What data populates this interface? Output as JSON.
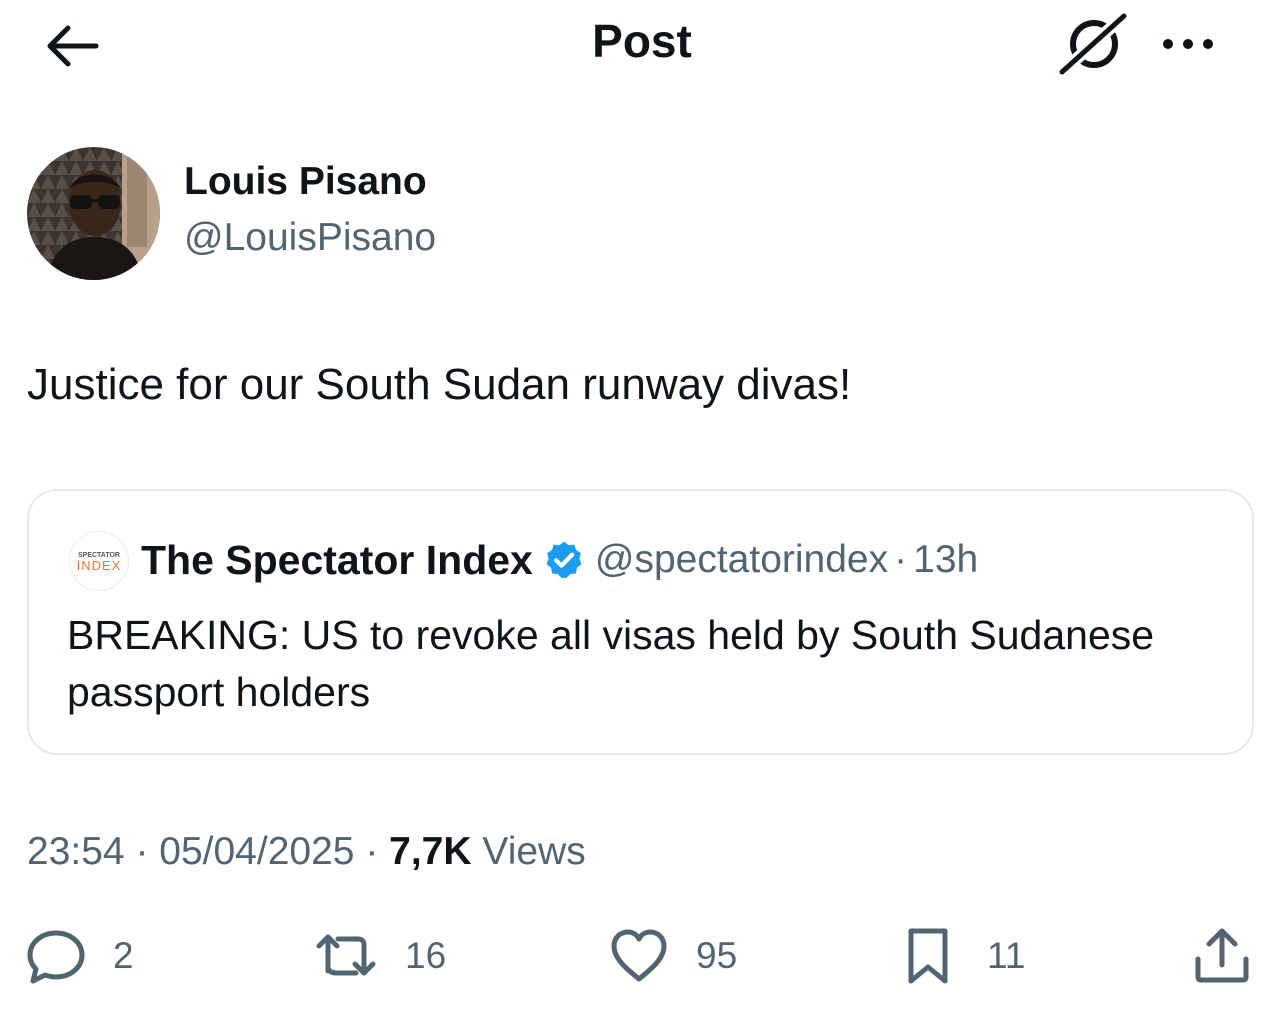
{
  "header": {
    "title": "Post",
    "back_icon": "arrow-left-icon",
    "grok_icon": "grok-icon",
    "more_icon": "more-horizontal-icon"
  },
  "author": {
    "name": "Louis Pisano",
    "handle": "@LouisPisano",
    "avatar": "profile-photo"
  },
  "post": {
    "text": "Justice for our South Sudan runway divas!"
  },
  "quote": {
    "avatar_text_top": "SPECTATOR",
    "avatar_text_bottom": "INDEX",
    "name": "The Spectator Index",
    "verified_icon": "verified-badge-icon",
    "handle": "@spectatorindex",
    "separator": "·",
    "time": "13h",
    "text": "BREAKING: US to revoke all visas held by South Sudanese passport holders"
  },
  "meta": {
    "time": "23:54",
    "sep1": " · ",
    "date": "05/04/2025",
    "sep2": " · ",
    "views_count": "7,7K",
    "views_label": " Views"
  },
  "actions": {
    "replies": "2",
    "reposts": "16",
    "likes": "95",
    "bookmarks": "11"
  },
  "colors": {
    "text": "#0f1419",
    "secondary": "#536471",
    "border": "#e7e9ea",
    "verified": "#1d9bf0",
    "brand_orange": "#e2793a"
  }
}
